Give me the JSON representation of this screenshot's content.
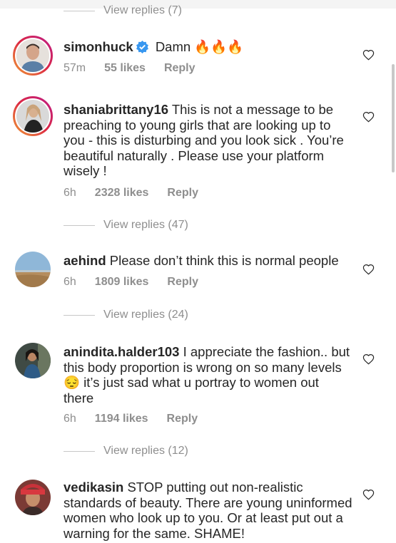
{
  "replies_top": "View replies (7)",
  "comments": [
    {
      "username": "simonhuck",
      "verified": true,
      "text": "Damn 🔥🔥🔥",
      "time": "57m",
      "likes": "55 likes",
      "reply": "Reply"
    },
    {
      "username": "shaniabrittany16",
      "text": "This is not a message to be preaching to young girls that are looking up to you - this is disturbing and you look sick . You’re beautiful naturally . Please use your platform wisely !",
      "time": "6h",
      "likes": "2328 likes",
      "reply": "Reply",
      "view_replies": "View replies (47)"
    },
    {
      "username": "aehind",
      "text": "Please don’t think this is normal people",
      "time": "6h",
      "likes": "1809 likes",
      "reply": "Reply",
      "view_replies": "View replies (24)"
    },
    {
      "username": "anindita.halder103",
      "text": "I appreciate the fashion.. but this body proportion is wrong on so many levels 😔 it’s just sad what u portray to women out there",
      "time": "6h",
      "likes": "1194 likes",
      "reply": "Reply",
      "view_replies": "View replies (12)"
    },
    {
      "username": "vedikasin",
      "text": "STOP putting out non-realistic standards of beauty. There are young uninformed women who look up to you. Or at least put out a warning for the same. SHAME!"
    }
  ]
}
